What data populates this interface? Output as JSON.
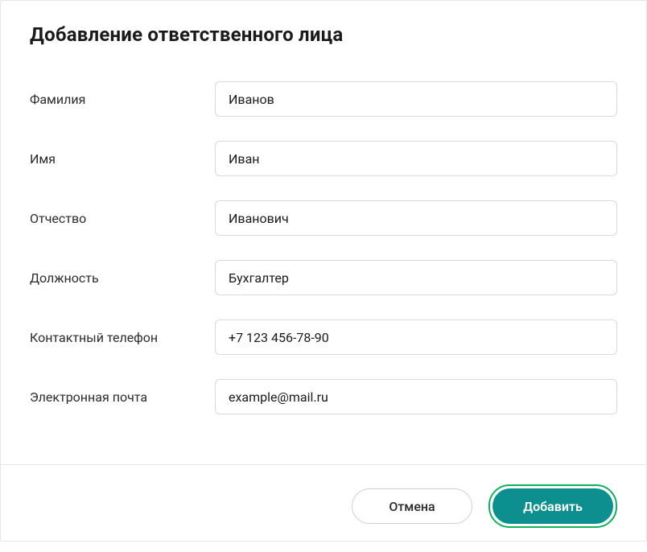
{
  "dialog": {
    "title": "Добавление ответственного лица"
  },
  "form": {
    "surname": {
      "label": "Фамилия",
      "value": "Иванов"
    },
    "name": {
      "label": "Имя",
      "value": "Иван"
    },
    "patronymic": {
      "label": "Отчество",
      "value": "Иванович"
    },
    "position": {
      "label": "Должность",
      "value": "Бухгалтер"
    },
    "phone": {
      "label": "Контактный телефон",
      "value": "+7 123 456-78-90"
    },
    "email": {
      "label": "Электронная почта",
      "value": "example@mail.ru"
    }
  },
  "buttons": {
    "cancel": "Отмена",
    "submit": "Добавить"
  }
}
